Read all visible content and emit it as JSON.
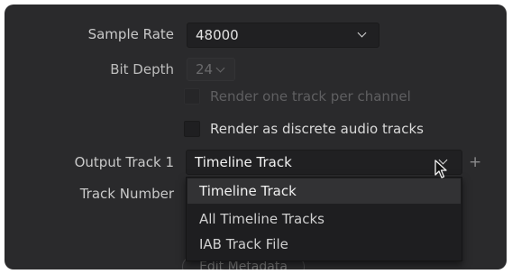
{
  "sample_rate": {
    "label": "Sample Rate",
    "value": "48000"
  },
  "bit_depth": {
    "label": "Bit Depth",
    "value": "24"
  },
  "options": {
    "render_one_track": "Render one track per channel",
    "render_discrete": "Render as discrete audio tracks"
  },
  "output_track": {
    "label": "Output Track 1",
    "value": "Timeline Track",
    "add_icon": "+"
  },
  "track_number": {
    "label": "Track Number"
  },
  "dropdown": {
    "items": [
      "Timeline Track",
      "All Timeline Tracks",
      "IAB Track File"
    ]
  },
  "edit_metadata_label": "Edit Metadata",
  "colors": {
    "panel_bg": "#2a2a2c",
    "field_bg": "#202022",
    "selected_option_bg": "#323234"
  }
}
